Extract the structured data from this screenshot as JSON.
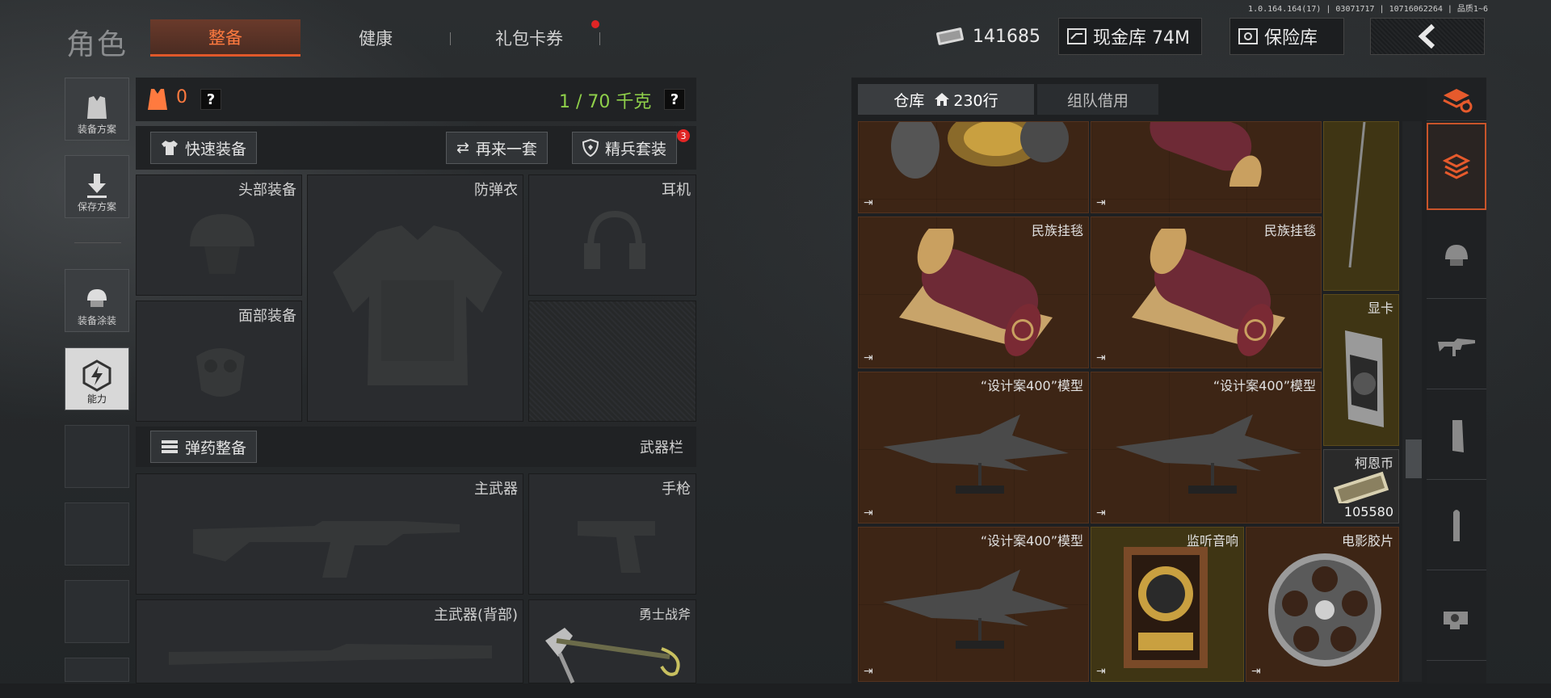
{
  "version": "1.0.164.164(17) | 03071717 | 10716062264 | 品质1~6",
  "title": "角色",
  "tabs": [
    {
      "label": "整备",
      "active": true
    },
    {
      "label": "健康",
      "active": false
    },
    {
      "label": "礼包卡券",
      "active": false,
      "dot": true
    }
  ],
  "currency": {
    "cash": "141685",
    "vault_label": "现金库 74M",
    "insurance_label": "保险库",
    "back_icon": "back-arrow-icon"
  },
  "left_menu": [
    {
      "label": "装备方案",
      "icon": "vest-icon"
    },
    {
      "label": "保存方案",
      "icon": "download-icon"
    },
    {
      "label": "装备涂装",
      "icon": "helmet-paint-icon"
    },
    {
      "label": "能力",
      "icon": "lightning-hex-icon",
      "selected": true
    }
  ],
  "equip": {
    "armor_count": "0",
    "weight": "1 / 70 千克",
    "help": "?",
    "quick_equip": "快速装备",
    "again": "再来一套",
    "elite": "精兵套装",
    "elite_badge": "3",
    "slots": {
      "head": "头部装备",
      "vest": "防弹衣",
      "headset": "耳机",
      "face": "面部装备",
      "primary": "主武器",
      "pistol": "手枪",
      "primary_back": "主武器(背部)",
      "melee": "勇士战斧"
    },
    "ammo": "弹药整备",
    "weapon_bar": "武器栏"
  },
  "storage": {
    "tab_warehouse": "仓库",
    "rows": "230行",
    "tab_team": "组队借用",
    "items": [
      {
        "label": ""
      },
      {
        "label": ""
      },
      {
        "label": "民族挂毯"
      },
      {
        "label": "民族挂毯"
      },
      {
        "label": "显卡"
      },
      {
        "label": "“设计案400”模型"
      },
      {
        "label": "“设计案400”模型"
      },
      {
        "label": "柯恩币",
        "count": "105580"
      },
      {
        "label": "“设计案400”模型"
      },
      {
        "label": "监听音响"
      },
      {
        "label": "电影胶片"
      }
    ]
  },
  "right_categories": [
    "sort-icon",
    "all-items-icon",
    "helmet-icon",
    "rifle-icon",
    "magazine-icon",
    "ammo-icon",
    "scope-icon"
  ],
  "colors": {
    "accent": "#ff7a3f",
    "weight": "#8fd04a",
    "cell_brown": "#3d2515",
    "cell_gold": "#3f3514"
  }
}
